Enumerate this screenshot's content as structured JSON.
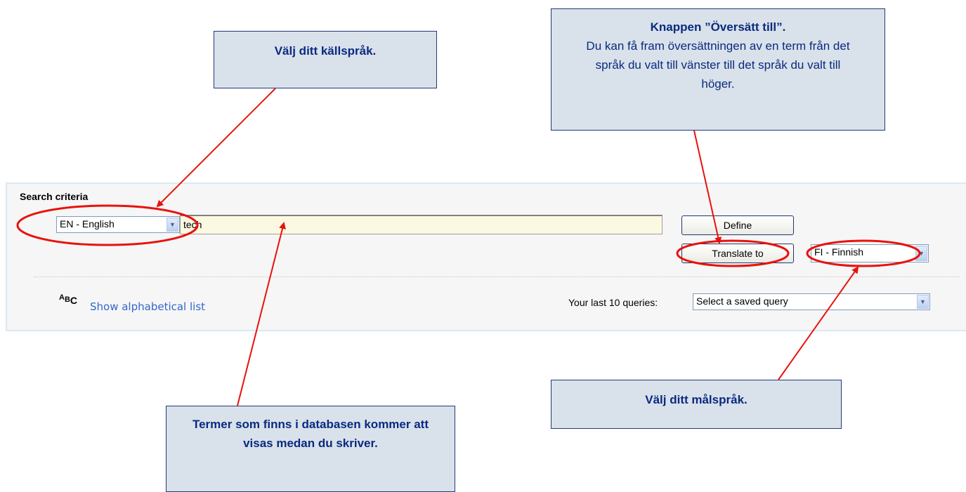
{
  "search": {
    "title": "Search criteria",
    "source_language": "EN - English",
    "query_value": "tech",
    "define_label": "Define",
    "translate_label": "Translate to",
    "target_language": "FI - Finnish",
    "alphabetical_icon": "ABC",
    "alphabetical_link": "Show alphabetical list",
    "last_queries_label": "Your last 10 queries:",
    "saved_query_placeholder": "Select a saved query"
  },
  "callouts": {
    "source": "Välj ditt källspråk.",
    "translate_title": "Knappen ”Översätt till”.",
    "translate_body": "Du kan få fram översättningen av en term från det språk du valt till vänster till det språk du valt till höger.",
    "target": "Välj ditt målspråk.",
    "terms": "Termer som finns i databasen kommer att visas medan du skriver."
  },
  "colors": {
    "annotation": "#e8120c",
    "callout_text": "#0a2a80",
    "callout_bg": "#d9e1ea",
    "link": "#3366cc",
    "input_bg": "#fbf9e2"
  }
}
